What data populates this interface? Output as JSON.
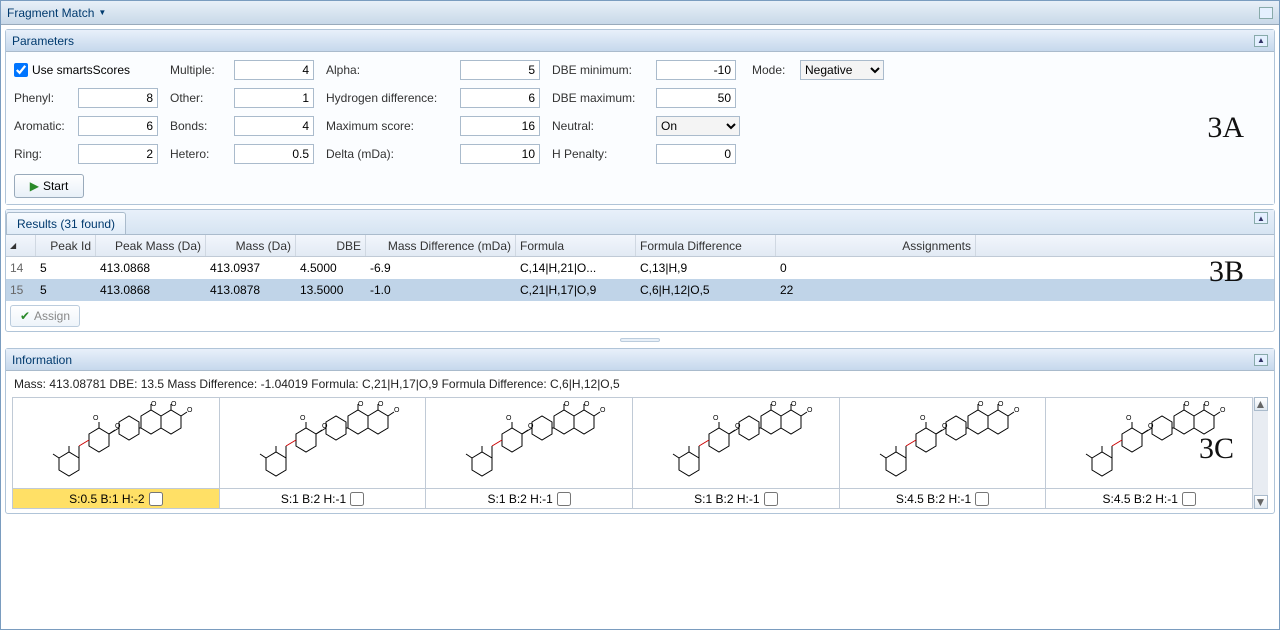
{
  "window": {
    "title": "Fragment Match"
  },
  "parameters": {
    "title": "Parameters",
    "use_smarts_label": "Use smartsScores",
    "use_smarts_checked": true,
    "fields": {
      "phenyl_label": "Phenyl:",
      "phenyl": "8",
      "aromatic_label": "Aromatic:",
      "aromatic": "6",
      "ring_label": "Ring:",
      "ring": "2",
      "multiple_label": "Multiple:",
      "multiple": "4",
      "other_label": "Other:",
      "other": "1",
      "bonds_label": "Bonds:",
      "bonds": "4",
      "hetero_label": "Hetero:",
      "hetero": "0.5",
      "alpha_label": "Alpha:",
      "alpha": "5",
      "hdiff_label": "Hydrogen difference:",
      "hdiff": "6",
      "maxscore_label": "Maximum score:",
      "maxscore": "16",
      "delta_label": "Delta (mDa):",
      "delta": "10",
      "dbemin_label": "DBE minimum:",
      "dbemin": "-10",
      "dbemax_label": "DBE maximum:",
      "dbemax": "50",
      "neutral_label": "Neutral:",
      "neutral": "On",
      "hpen_label": "H Penalty:",
      "hpen": "0",
      "mode_label": "Mode:",
      "mode": "Negative"
    },
    "start_label": "Start",
    "section_tag": "3A"
  },
  "results": {
    "tab_label": "Results (31 found)",
    "columns": [
      "",
      "Peak Id",
      "Peak Mass (Da)",
      "Mass (Da)",
      "DBE",
      "Mass Difference (mDa)",
      "Formula",
      "Formula Difference",
      "Assignments"
    ],
    "rows": [
      {
        "n": "14",
        "peak_id": "5",
        "peak_mass": "413.0868",
        "mass": "413.0937",
        "dbe": "4.5000",
        "mdiff": "-6.9",
        "formula": "C,14|H,21|O...",
        "fdiff": "C,13|H,9",
        "assign": "0",
        "selected": false
      },
      {
        "n": "15",
        "peak_id": "5",
        "peak_mass": "413.0868",
        "mass": "413.0878",
        "dbe": "13.5000",
        "mdiff": "-1.0",
        "formula": "C,21|H,17|O,9",
        "fdiff": "C,6|H,12|O,5",
        "assign": "22",
        "selected": true
      }
    ],
    "assign_label": "Assign",
    "section_tag": "3B"
  },
  "information": {
    "title": "Information",
    "detail": "Mass:  413.08781   DBE:  13.5   Mass Difference:  -1.04019   Formula:  C,21|H,17|O,9   Formula Difference:  C,6|H,12|O,5",
    "thumbs": [
      {
        "caption": "S:0.5 B:1 H:-2",
        "highlight": true
      },
      {
        "caption": "S:1 B:2 H:-1",
        "highlight": false
      },
      {
        "caption": "S:1 B:2 H:-1",
        "highlight": false
      },
      {
        "caption": "S:1 B:2 H:-1",
        "highlight": false
      },
      {
        "caption": "S:4.5 B:2 H:-1",
        "highlight": false
      },
      {
        "caption": "S:4.5 B:2 H:-1",
        "highlight": false
      }
    ],
    "section_tag": "3C"
  }
}
